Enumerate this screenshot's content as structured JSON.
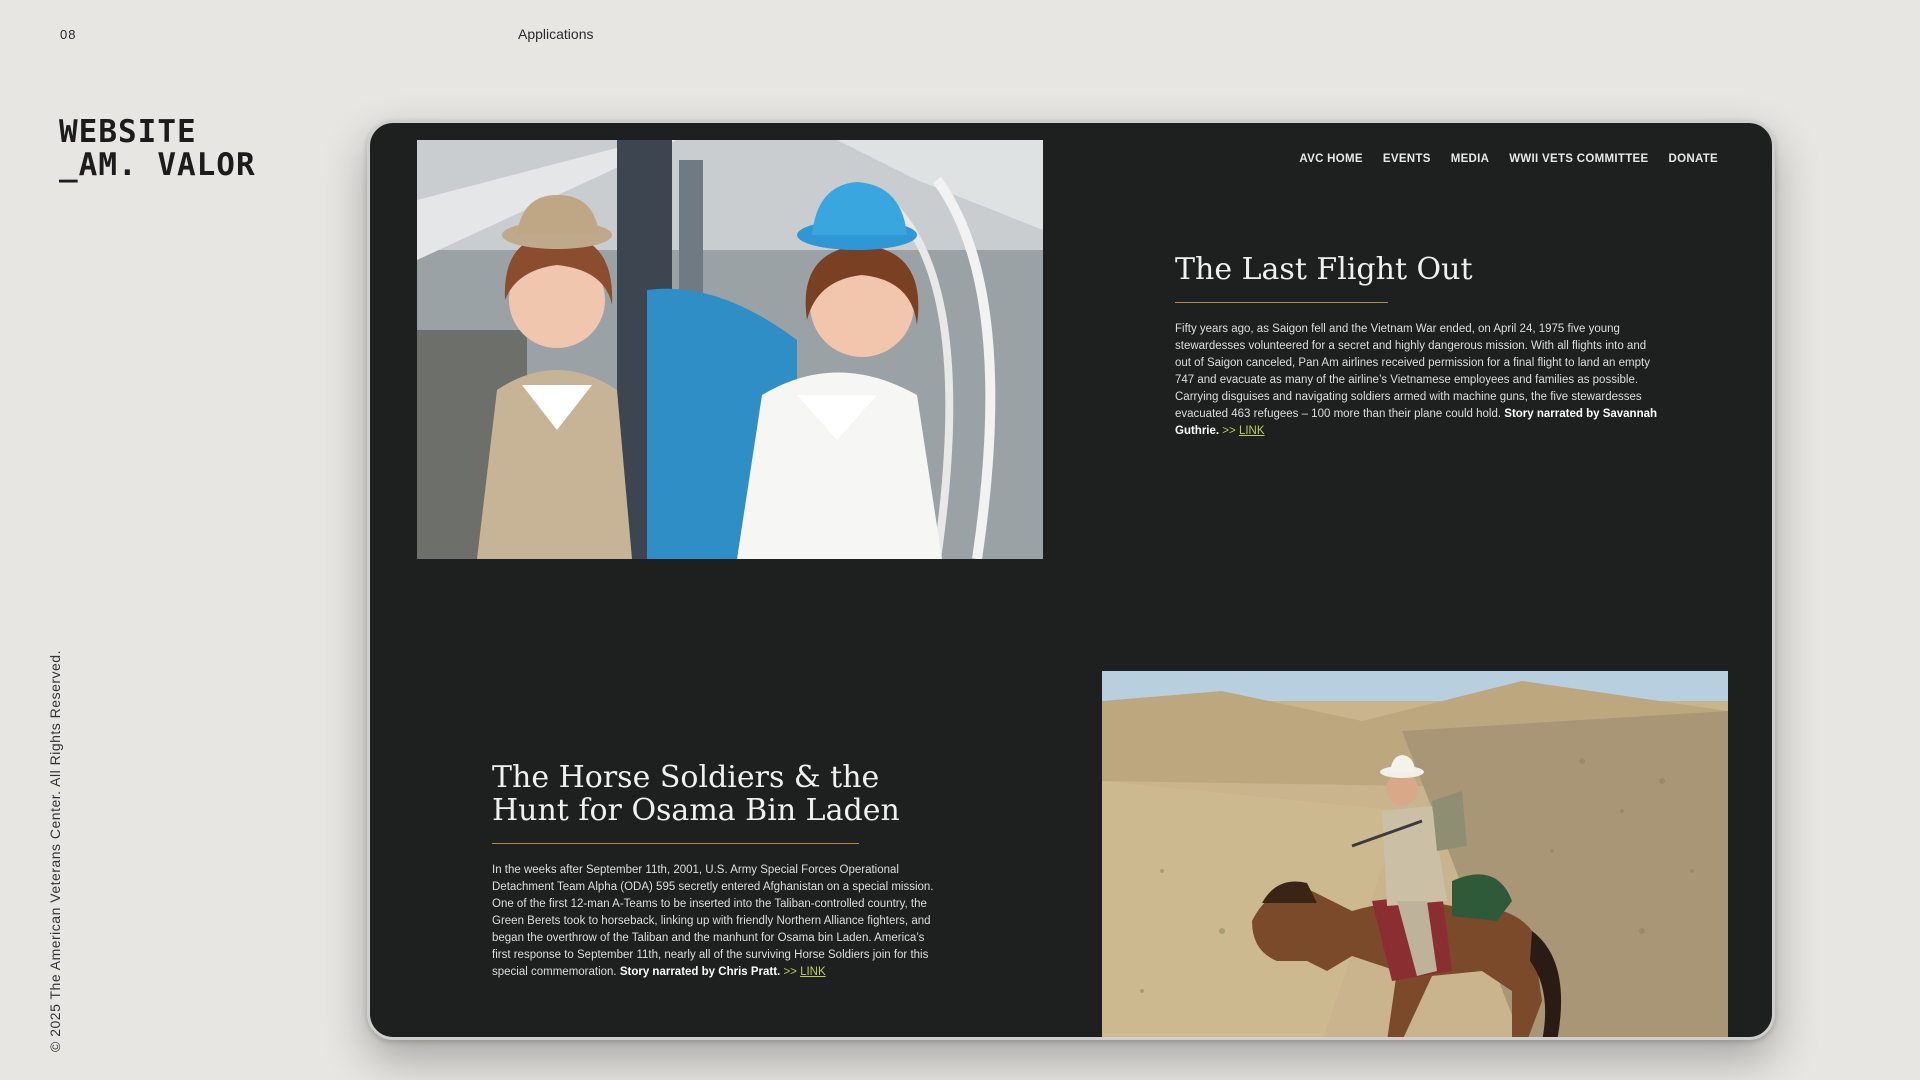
{
  "slide": {
    "page_number": "08",
    "section": "Applications",
    "title_line1": "WEBSITE",
    "title_line2": "_AM. VALOR",
    "copyright": "© 2025 The American Veterans Center. All Rights Reserved."
  },
  "nav": {
    "items": [
      "AVC HOME",
      "EVENTS",
      "MEDIA",
      "WWII VETS COMMITTEE",
      "DONATE"
    ]
  },
  "stories": [
    {
      "title": "The Last Flight Out",
      "body": "Fifty years ago, as Saigon fell and the Vietnam War ended, on April 24, 1975 five young stewardesses volunteered for a secret and highly dangerous mission. With all flights into and out of Saigon canceled, Pan Am airlines received permission for a final flight to land an empty 747 and evacuate as many of the airline’s Vietnamese employees and families as possible. Carrying disguises and navigating soldiers armed with machine guns, the five stewardesses evacuated 463 refugees – 100 more than their plane could hold.",
      "credit": "Story narrated by Savannah Guthrie.",
      "arrow": ">>",
      "link": "LINK"
    },
    {
      "title": "The Horse Soldiers & the Hunt for Osama Bin Laden",
      "body": "In the weeks after September 11th, 2001, U.S. Army Special Forces Operational Detachment Team Alpha (ODA) 595 secretly entered Afghanistan on a special mission.  One of the first 12-man A-Teams to be inserted into the Taliban-controlled country, the Green Berets took to horseback, linking up with friendly Northern Alliance fighters, and began the overthrow of the Taliban and the manhunt for Osama bin Laden.  America’s first response to September 11th, nearly all of the surviving Horse Soldiers join for this special commemoration.",
      "credit": "Story narrated by Chris Pratt.",
      "arrow": ">>",
      "link": "LINK"
    }
  ],
  "colors": {
    "page_background": "#e7e6e2",
    "screen_background": "#1e1f1f",
    "rule_gold": "#b08a3e",
    "link_green": "#b5d05a"
  }
}
